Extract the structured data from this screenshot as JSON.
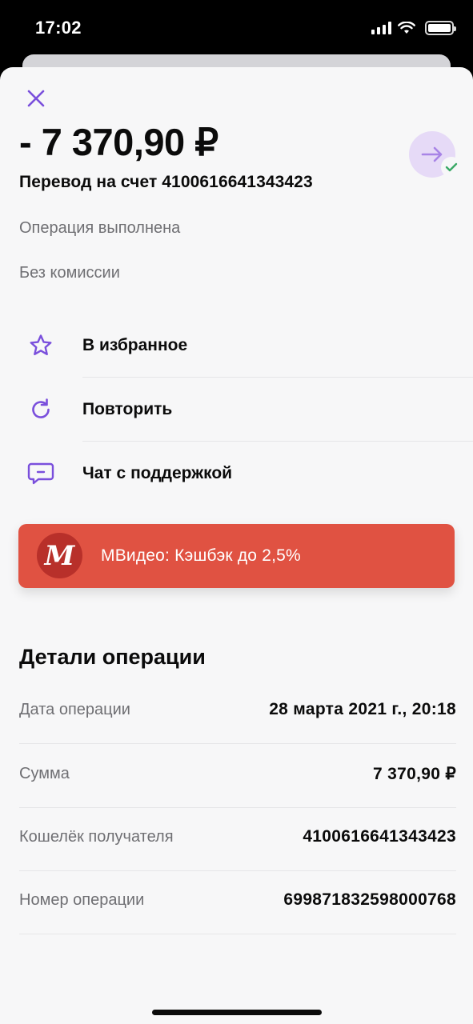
{
  "status_bar": {
    "time": "17:02"
  },
  "header": {
    "amount": "- 7 370,90 ₽",
    "title": "Перевод на счет 4100616641343423",
    "status": "Операция выполнена",
    "commission": "Без комиссии"
  },
  "actions": [
    {
      "label": "В избранное",
      "icon": "star-icon"
    },
    {
      "label": "Повторить",
      "icon": "repeat-icon"
    },
    {
      "label": "Чат с поддержкой",
      "icon": "chat-icon"
    }
  ],
  "promo": {
    "logo_letter": "М",
    "text": "МВидео: Кэшбэк до 2,5%",
    "color": "#e05242"
  },
  "details": {
    "title": "Детали операции",
    "rows": [
      {
        "label": "Дата операции",
        "value": "28 марта 2021 г., 20:18"
      },
      {
        "label": "Сумма",
        "value": "7 370,90 ₽"
      },
      {
        "label": "Кошелёк получателя",
        "value": "4100616641343423"
      },
      {
        "label": "Номер операции",
        "value": "699871832598000768"
      }
    ]
  },
  "colors": {
    "accent": "#7a4fdc",
    "success": "#3aa866",
    "promo": "#e05242"
  }
}
